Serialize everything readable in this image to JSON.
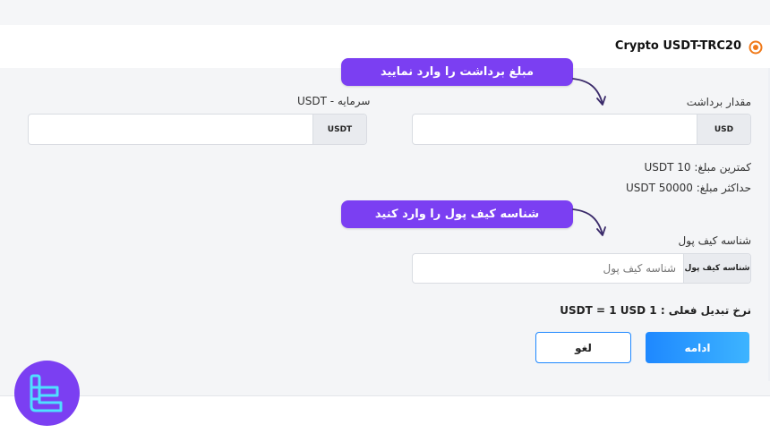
{
  "header": {
    "title": "Crypto USDT-TRC20"
  },
  "withdraw_amount": {
    "label": "مقدار برداشت",
    "currency": "USD",
    "value": ""
  },
  "capital": {
    "label": "USDT - سرمایه",
    "currency": "USDT",
    "value": ""
  },
  "limits": {
    "min": "کمترین مبلغ: USDT 10",
    "max": "حداکثر مبلغ: USDT 50000"
  },
  "wallet": {
    "label": "شناسه کیف پول",
    "addon": "شناسه کیف پول",
    "placeholder": "شناسه کیف پول",
    "value": ""
  },
  "exchange_rate": "نرخ تبدیل فعلی : USDT = 1 USD 1",
  "buttons": {
    "continue": "ادامه",
    "cancel": "لغو"
  },
  "callouts": {
    "amount": "مبلغ برداشت را وارد نمایید",
    "wallet": "شناسه کیف پول را وارد کنید"
  },
  "colors": {
    "accent": "#1e88ff",
    "callout": "#7b3ff2",
    "logo_orange": "#f07a1a"
  }
}
